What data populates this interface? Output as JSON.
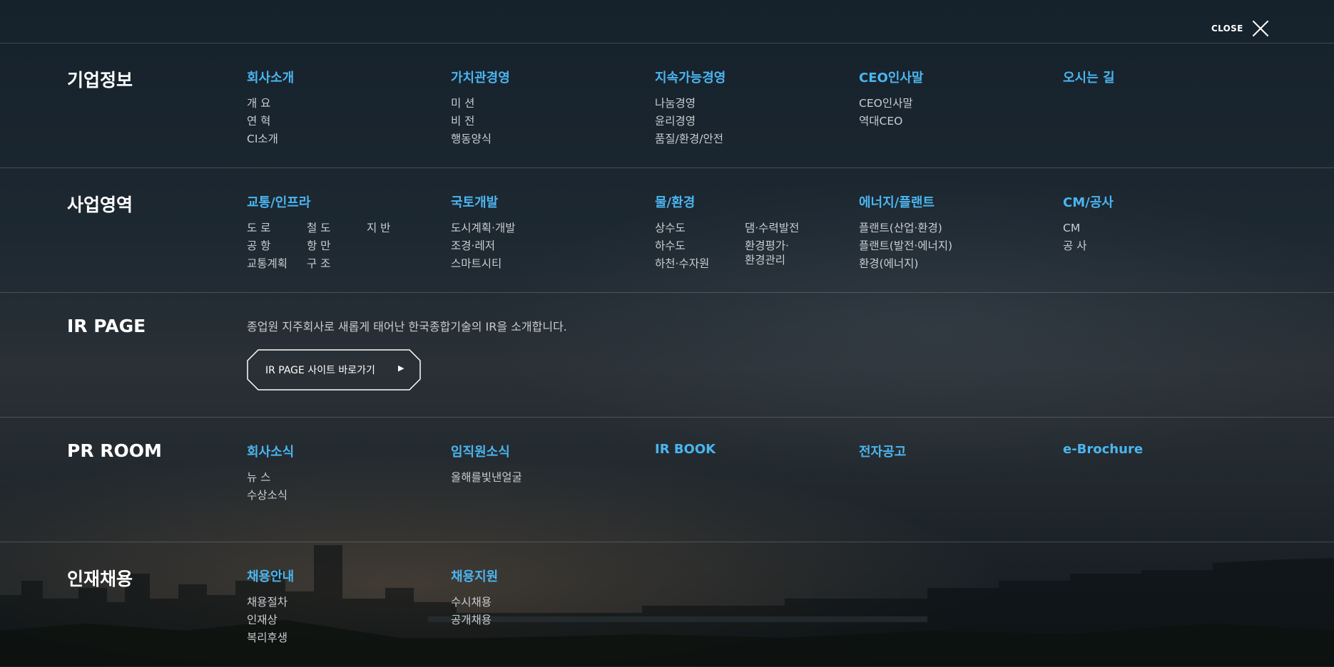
{
  "close": {
    "label": "CLOSE"
  },
  "sections": {
    "company": {
      "title": "기업정보",
      "cols": [
        {
          "head": "회사소개",
          "items": [
            "개 요",
            "연 혁",
            "CI소개"
          ]
        },
        {
          "head": "가치관경영",
          "items": [
            "미 션",
            "비 전",
            "행동양식"
          ]
        },
        {
          "head": "지속가능경영",
          "items": [
            "나눔경영",
            "윤리경영",
            "품질/환경/안전"
          ]
        },
        {
          "head": "CEO인사말",
          "items": [
            "CEO인사말",
            "역대CEO"
          ]
        },
        {
          "head": "오시는 길",
          "items": []
        }
      ]
    },
    "business": {
      "title": "사업영역",
      "cols": [
        {
          "head": "교통/인프라",
          "items": [
            "도 로",
            "철 도",
            "지 반",
            "공 항",
            "항 만",
            "교통계획",
            "구 조"
          ]
        },
        {
          "head": "국토개발",
          "items": [
            "도시계획·개발",
            "조경·레저",
            "스마트시티"
          ]
        },
        {
          "head": "물/환경",
          "left": [
            "상수도",
            "하수도",
            "하천·수자원"
          ],
          "right": [
            "댐·수력발전",
            "환경평가·",
            "환경관리"
          ]
        },
        {
          "head": "에너지/플랜트",
          "items": [
            "플랜트(산업·환경)",
            "플랜트(발전·에너지)",
            "환경(에너지)"
          ]
        },
        {
          "head": "CM/공사",
          "items": [
            "CM",
            "공 사"
          ]
        }
      ]
    },
    "ir": {
      "title": "IR PAGE",
      "desc": "종업원 지주회사로 새롭게 태어난 한국종합기술의 IR을 소개합니다.",
      "button": "IR PAGE 사이트 바로가기",
      "arrow": "▶"
    },
    "pr": {
      "title": "PR ROOM",
      "cols": [
        {
          "head": "회사소식",
          "items": [
            "뉴 스",
            "수상소식"
          ]
        },
        {
          "head": "임직원소식",
          "items": [
            "올해를빛낸얼굴"
          ]
        },
        {
          "head": "IR BOOK",
          "items": []
        },
        {
          "head": "전자공고",
          "items": []
        },
        {
          "head": "e-Brochure",
          "items": []
        }
      ]
    },
    "recruit": {
      "title": "인재채용",
      "cols": [
        {
          "head": "채용안내",
          "items": [
            "채용절차",
            "인재상",
            "복리후생"
          ]
        },
        {
          "head": "채용지원",
          "items": [
            "수시채용",
            "공개채용"
          ]
        }
      ]
    }
  },
  "colors": {
    "accent": "#4bb5f0",
    "item": "#c9cdd1",
    "title": "#ffffff"
  }
}
